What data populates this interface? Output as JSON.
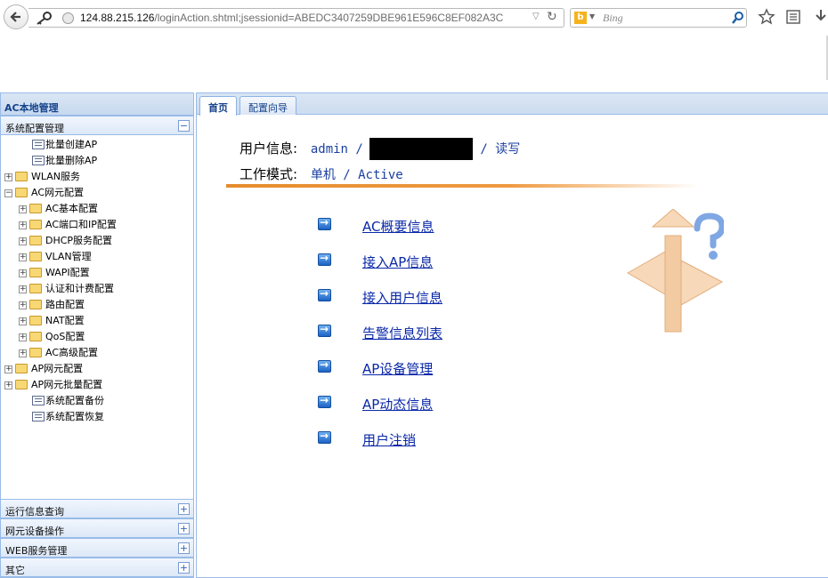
{
  "browser": {
    "url_host": "124.88.215.126",
    "url_rest": "/loginAction.shtml;jsessionid=ABEDC3407259DBE961E596C8EF082A3C",
    "search_placeholder": "Bing",
    "search_engine_icon": "bing-icon"
  },
  "sidebar": {
    "title": "AC本地管理",
    "section_main": "系统配置管理",
    "tree": [
      {
        "label": "批量创建AP",
        "type": "leaf",
        "depth": 1
      },
      {
        "label": "批量删除AP",
        "type": "leaf",
        "depth": 1
      },
      {
        "label": "WLAN服务",
        "type": "folder",
        "depth": 0
      },
      {
        "label": "AC网元配置",
        "type": "folder-open",
        "depth": 0
      },
      {
        "label": "AC基本配置",
        "type": "folder",
        "depth": 1
      },
      {
        "label": "AC端口和IP配置",
        "type": "folder",
        "depth": 1
      },
      {
        "label": "DHCP服务配置",
        "type": "folder",
        "depth": 1
      },
      {
        "label": "VLAN管理",
        "type": "folder",
        "depth": 1
      },
      {
        "label": "WAPI配置",
        "type": "folder",
        "depth": 1
      },
      {
        "label": "认证和计费配置",
        "type": "folder",
        "depth": 1
      },
      {
        "label": "路由配置",
        "type": "folder",
        "depth": 1
      },
      {
        "label": "NAT配置",
        "type": "folder",
        "depth": 1
      },
      {
        "label": "QoS配置",
        "type": "folder",
        "depth": 1
      },
      {
        "label": "AC高级配置",
        "type": "folder",
        "depth": 1
      },
      {
        "label": "AP网元配置",
        "type": "folder",
        "depth": 0
      },
      {
        "label": "AP网元批量配置",
        "type": "folder",
        "depth": 0
      },
      {
        "label": "系统配置备份",
        "type": "leaf",
        "depth": 1
      },
      {
        "label": "系统配置恢复",
        "type": "leaf",
        "depth": 1
      }
    ],
    "bottom_sections": [
      "运行信息查询",
      "网元设备操作",
      "WEB服务管理",
      "其它"
    ],
    "collapse_symbol": "−",
    "expand_symbol": "+"
  },
  "tabs": [
    {
      "label": "首页",
      "active": true
    },
    {
      "label": "配置向导",
      "active": false
    }
  ],
  "user_info": {
    "label": "用户信息:",
    "user": "admin /",
    "permission": "/ 读写"
  },
  "work_mode": {
    "label": "工作模式:",
    "value": "单机 / Active"
  },
  "links": [
    "AC概要信息",
    "接入AP信息",
    "接入用户信息",
    "告警信息列表",
    "AP设备管理",
    "AP动态信息",
    "用户注销"
  ]
}
